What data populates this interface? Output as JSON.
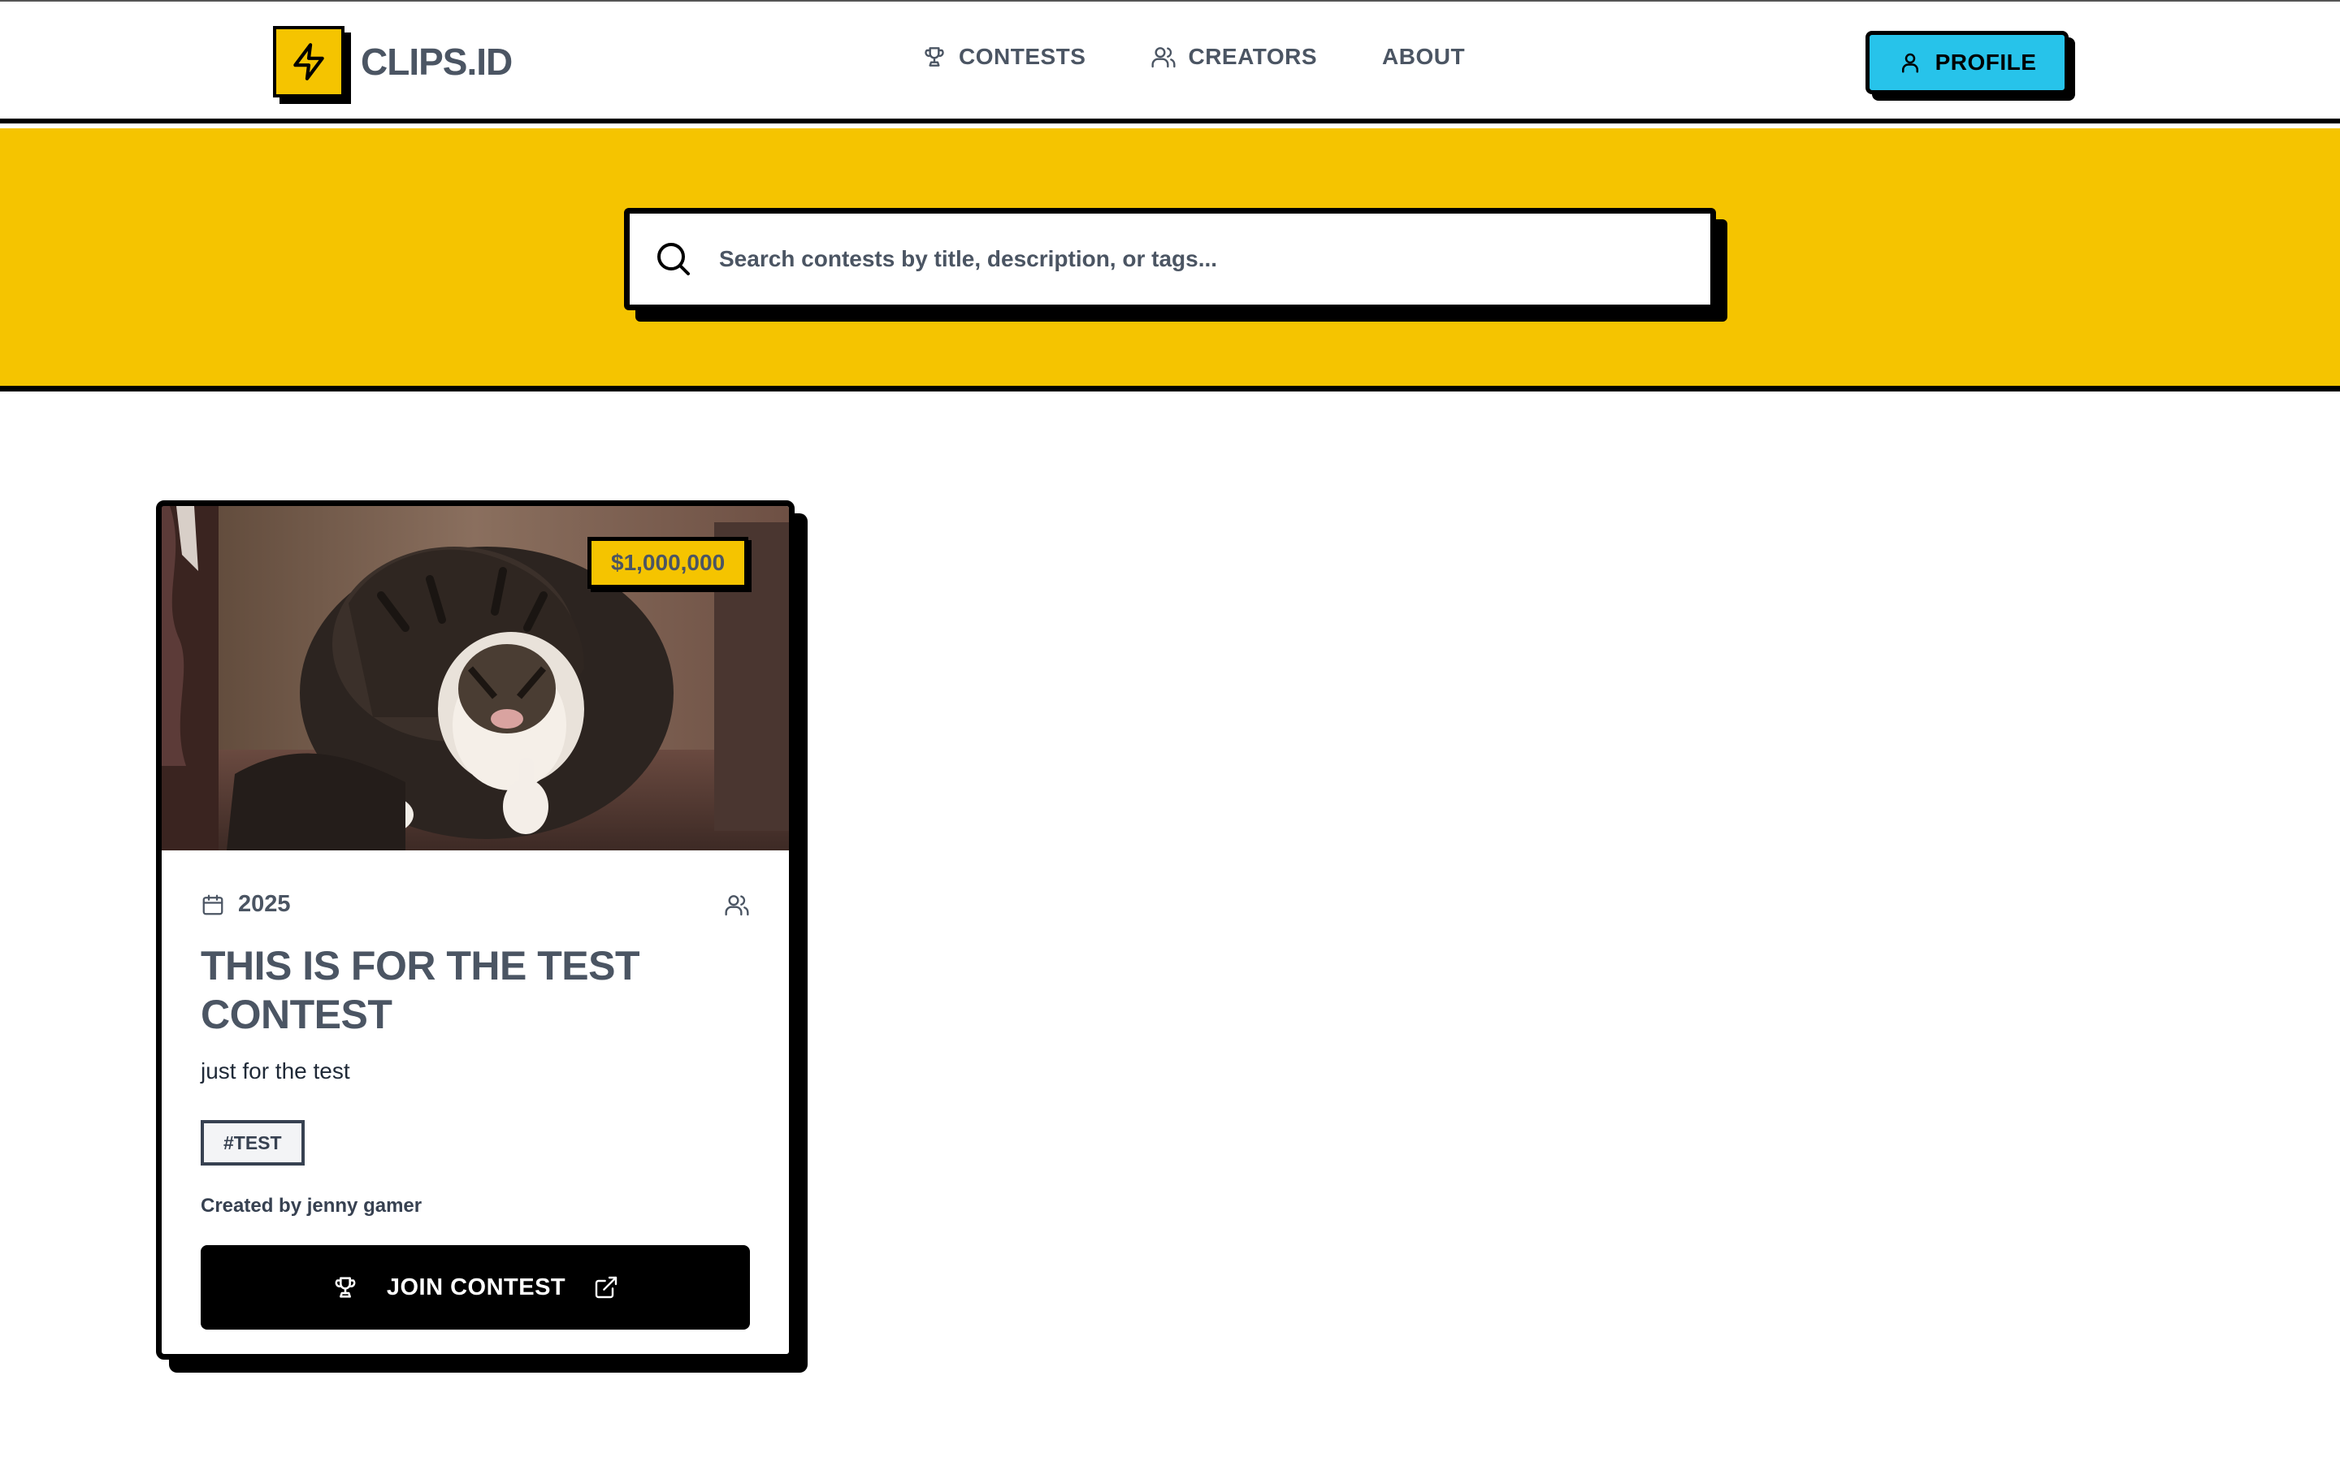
{
  "brand": {
    "name": "CLIPS.ID",
    "logo_icon": "lightning-icon",
    "accent": "#f5c400"
  },
  "nav": {
    "items": [
      {
        "label": "CONTESTS",
        "icon": "trophy-icon"
      },
      {
        "label": "CREATORS",
        "icon": "users-icon"
      },
      {
        "label": "ABOUT"
      }
    ]
  },
  "profile": {
    "label": "PROFILE",
    "icon": "user-icon",
    "color": "#27c3ea"
  },
  "search": {
    "placeholder": "Search contests by title, description, or tags..."
  },
  "contest": {
    "prize": "$1,000,000",
    "year": "2025",
    "title": "THIS IS FOR THE TEST CONTEST",
    "description": "just for the test",
    "tag": "#TEST",
    "creator": "Created by jenny gamer",
    "join_label": "JOIN CONTEST",
    "image": "cat-thumbs-up-photo"
  }
}
